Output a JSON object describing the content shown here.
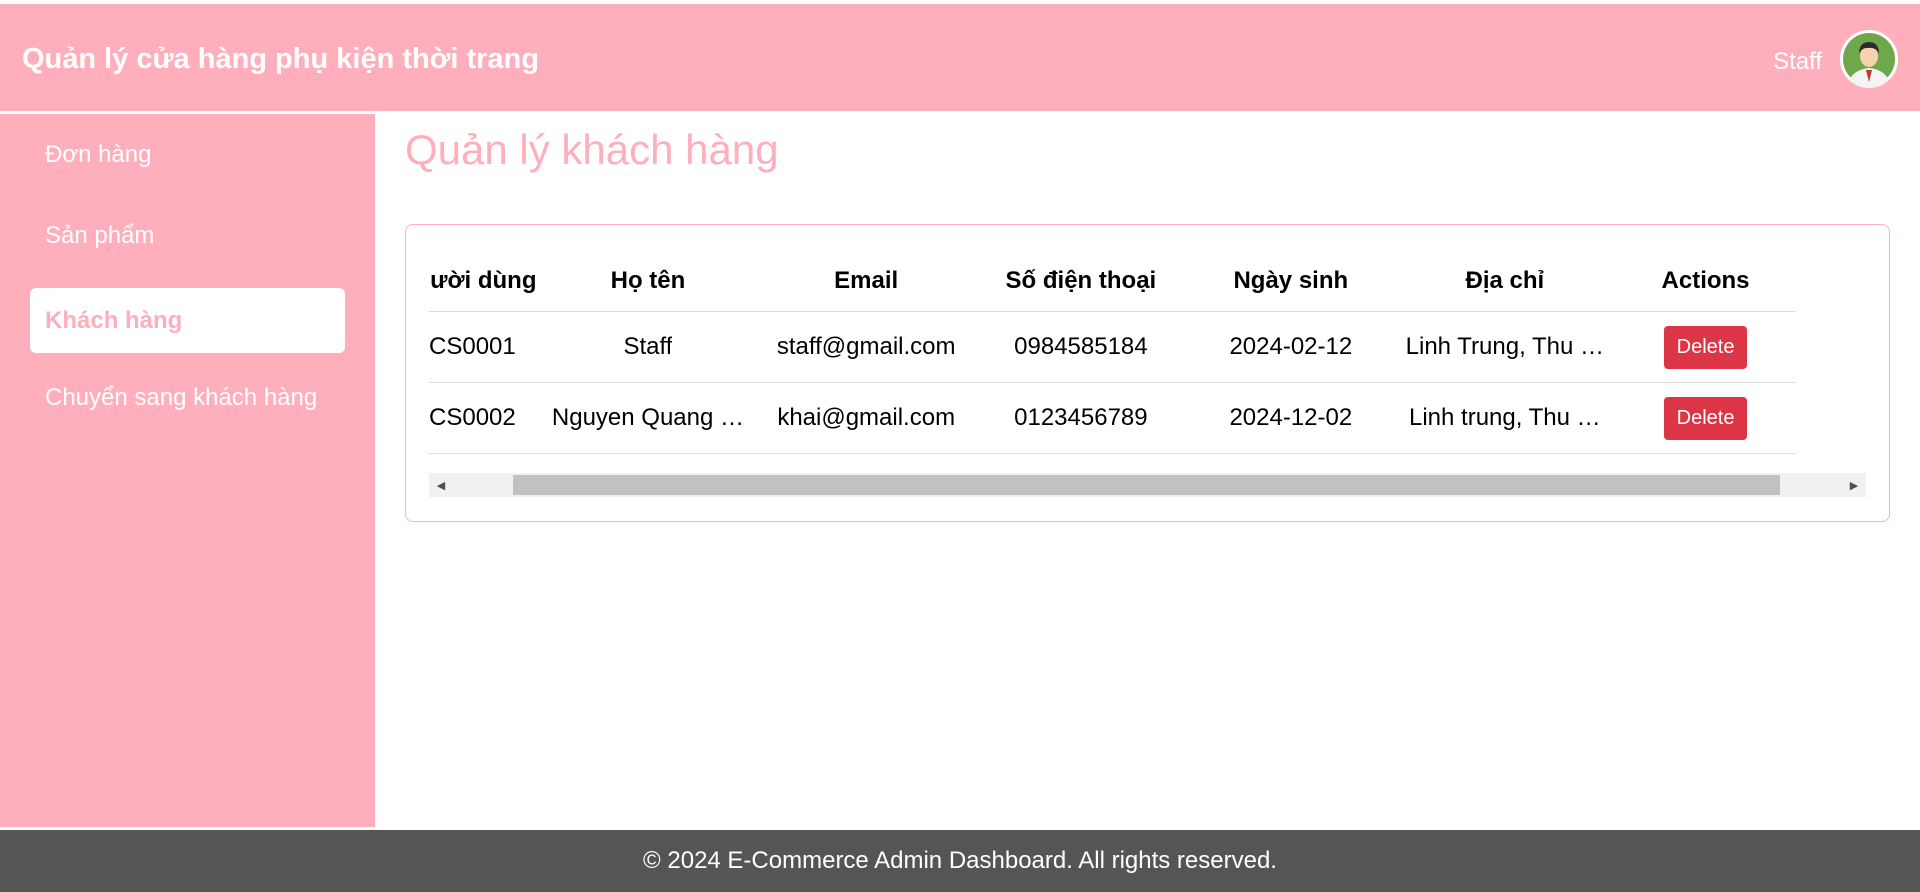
{
  "header": {
    "title": "Quản lý cửa hàng phụ kiện thời trang",
    "user_name": "Staff",
    "avatar_icon": "user-avatar-icon"
  },
  "sidebar": {
    "items": [
      {
        "label": "Đơn hàng",
        "active": false
      },
      {
        "label": "Sản phẩm",
        "active": false
      },
      {
        "label": "Khách hàng",
        "active": true
      },
      {
        "label": "Chuyển sang khách hàng",
        "active": false
      }
    ]
  },
  "main": {
    "title": "Quản lý khách hàng",
    "table": {
      "headers": [
        "Mã người dùng",
        "Họ tên",
        "Email",
        "Số điện thoại",
        "Ngày sinh",
        "Địa chỉ",
        "Actions"
      ],
      "rows": [
        {
          "id": "CS0001",
          "name": "Staff",
          "email": "staff@gmail.com",
          "phone": "0984585184",
          "birthday": "2024-02-12",
          "address": "Linh Trung, Thu …",
          "action": "Delete"
        },
        {
          "id": "CS0002",
          "name": "Nguyen Quang …",
          "email": "khai@gmail.com",
          "phone": "0123456789",
          "birthday": "2024-12-02",
          "address": "Linh trung, Thu …",
          "action": "Delete"
        }
      ]
    }
  },
  "footer": {
    "text": "© 2024 E-Commerce Admin Dashboard. All rights reserved."
  },
  "colors": {
    "primary_pink": "#ffafbc",
    "delete_red": "#dc3545",
    "footer_bg": "#555555"
  }
}
